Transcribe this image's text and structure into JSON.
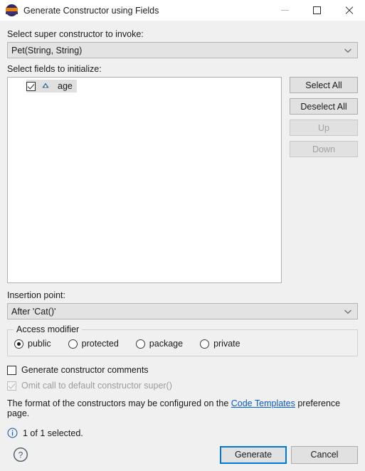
{
  "window": {
    "title": "Generate Constructor using Fields",
    "app_icon": "eclipse-icon",
    "minimize_label": "—",
    "maximize_label": "□",
    "close_label": "✕"
  },
  "super_constructor": {
    "label": "Select super constructor to invoke:",
    "selected": "Pet(String, String)"
  },
  "fields": {
    "label": "Select fields to initialize:",
    "items": [
      {
        "name": "age",
        "checked": true,
        "icon": "java-field-icon",
        "selected": true
      }
    ]
  },
  "side_buttons": [
    {
      "label": "Select All",
      "enabled": true
    },
    {
      "label": "Deselect All",
      "enabled": true
    },
    {
      "label": "Up",
      "enabled": false
    },
    {
      "label": "Down",
      "enabled": false
    }
  ],
  "insertion_point": {
    "label": "Insertion point:",
    "selected": "After 'Cat()'"
  },
  "access_modifier": {
    "group_label": "Access modifier",
    "options": [
      {
        "label": "public",
        "selected": true
      },
      {
        "label": "protected",
        "selected": false
      },
      {
        "label": "package",
        "selected": false
      },
      {
        "label": "private",
        "selected": false
      }
    ]
  },
  "options": {
    "generate_comments": {
      "label": "Generate constructor comments",
      "checked": false,
      "enabled": true
    },
    "omit_super": {
      "label": "Omit call to default constructor super()",
      "checked": true,
      "enabled": false
    }
  },
  "format_note": {
    "prefix": "The format of the constructors may be configured on the ",
    "link": "Code Templates",
    "suffix": " preference page."
  },
  "status": {
    "icon": "info-icon",
    "text": "1 of 1 selected."
  },
  "footer": {
    "help_label": "?",
    "generate_label": "Generate",
    "cancel_label": "Cancel"
  },
  "colors": {
    "dialog_bg": "#f0f0f0",
    "titlebar_bg": "#ffffff",
    "accent": "#0078d7",
    "link": "#0b5cc0",
    "field_icon": "#3a6fb0",
    "combo_bg": "#e3e3e3"
  }
}
